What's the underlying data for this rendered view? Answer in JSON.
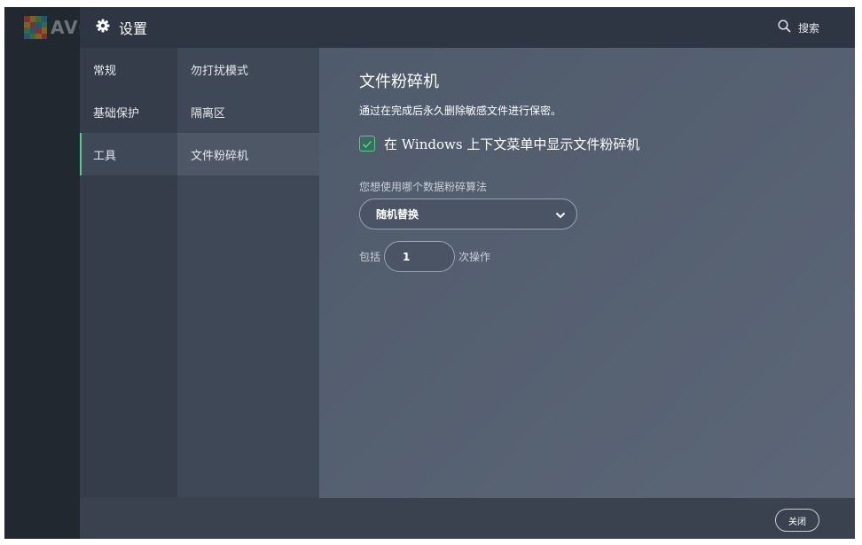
{
  "background_app": {
    "logo_text": "AVG"
  },
  "window": {
    "title": "设置",
    "search_label": "搜索"
  },
  "nav_primary": [
    {
      "label": "常规"
    },
    {
      "label": "基础保护"
    },
    {
      "label": "工具",
      "active": true
    }
  ],
  "nav_secondary": [
    {
      "label": "勿打扰模式"
    },
    {
      "label": "隔离区"
    },
    {
      "label": "文件粉碎机",
      "active": true
    }
  ],
  "content": {
    "title": "文件粉碎机",
    "description": "通过在完成后永久删除敏感文件进行保密。",
    "context_menu_checkbox": {
      "label": "在 Windows 上下文菜单中显示文件粉碎机",
      "checked": true
    },
    "algorithm_label": "您想使用哪个数据粉碎算法",
    "algorithm_value": "随机替换",
    "repeat_prefix": "包括",
    "repeat_value": "1",
    "repeat_suffix": "次操作"
  },
  "footer": {
    "close_label": "关闭"
  },
  "colors": {
    "accent": "#4ecf8b",
    "titlebar": "#2e3643",
    "content_bg": "#4f5a6b"
  },
  "icons": {
    "title": "gear-icon",
    "search": "search-icon",
    "checkbox": "checkmark-icon",
    "dropdown": "chevron-down-icon"
  }
}
